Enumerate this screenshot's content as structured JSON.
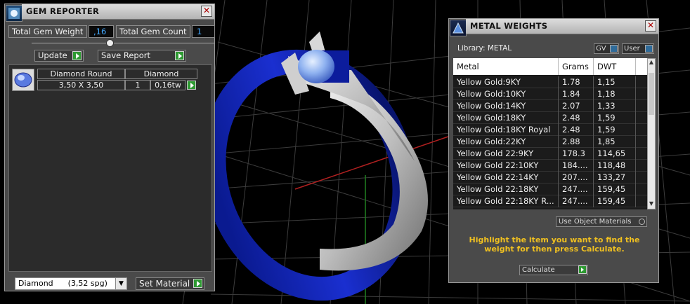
{
  "gem_reporter": {
    "title": "GEM REPORTER",
    "close_glyph": "✕",
    "total_gem_weight_label": "Total Gem Weight",
    "total_gem_weight_value": ",16",
    "total_gem_count_label": "Total Gem Count",
    "total_gem_count_value": "1",
    "update_label": "Update",
    "save_report_label": "Save Report",
    "gems": [
      {
        "icon": "round-gem-icon",
        "shape": "Diamond Round",
        "material": "Diamond",
        "size": "3,50 X 3,50",
        "count": "1",
        "weight": "0,16tw"
      }
    ],
    "material_select_value": "Diamond      (3,52 spg)",
    "set_material_label": "Set Material"
  },
  "metal_weights": {
    "title": "METAL WEIGHTS",
    "close_glyph": "✕",
    "library_label": "Library: METAL",
    "toggle_gv": "GV",
    "toggle_user": "User",
    "columns": [
      "Metal",
      "Grams",
      "DWT"
    ],
    "rows": [
      [
        "Yellow Gold:9KY",
        "1.78",
        "1,15"
      ],
      [
        "Yellow Gold:10KY",
        "1.84",
        "1,18"
      ],
      [
        "Yellow Gold:14KY",
        "2.07",
        "1,33"
      ],
      [
        "Yellow Gold:18KY",
        "2.48",
        "1,59"
      ],
      [
        "Yellow Gold:18KY Royal",
        "2.48",
        "1,59"
      ],
      [
        "Yellow Gold:22KY",
        "2.88",
        "1,85"
      ],
      [
        "Yellow Gold 22:9KY",
        "178.3",
        "114,65"
      ],
      [
        "Yellow Gold 22:10KY",
        "184....",
        "118,48"
      ],
      [
        "Yellow Gold 22:14KY",
        "207....",
        "133,27"
      ],
      [
        "Yellow Gold 22:18KY",
        "247....",
        "159,45"
      ],
      [
        "Yellow Gold 22:18KY R...",
        "247....",
        "159,45"
      ]
    ],
    "use_object_materials_label": "Use Object Materials",
    "hint": "Highlight the item you want to find the weight for then press Calculate.",
    "calculate_label": "Calculate"
  },
  "colors": {
    "accent_value": "#44a9ff",
    "button_green": "#2e9a32",
    "hint_yellow": "#f0c020",
    "ring_blue": "#0b1ea8",
    "ring_silver": "#c8c8c8"
  }
}
